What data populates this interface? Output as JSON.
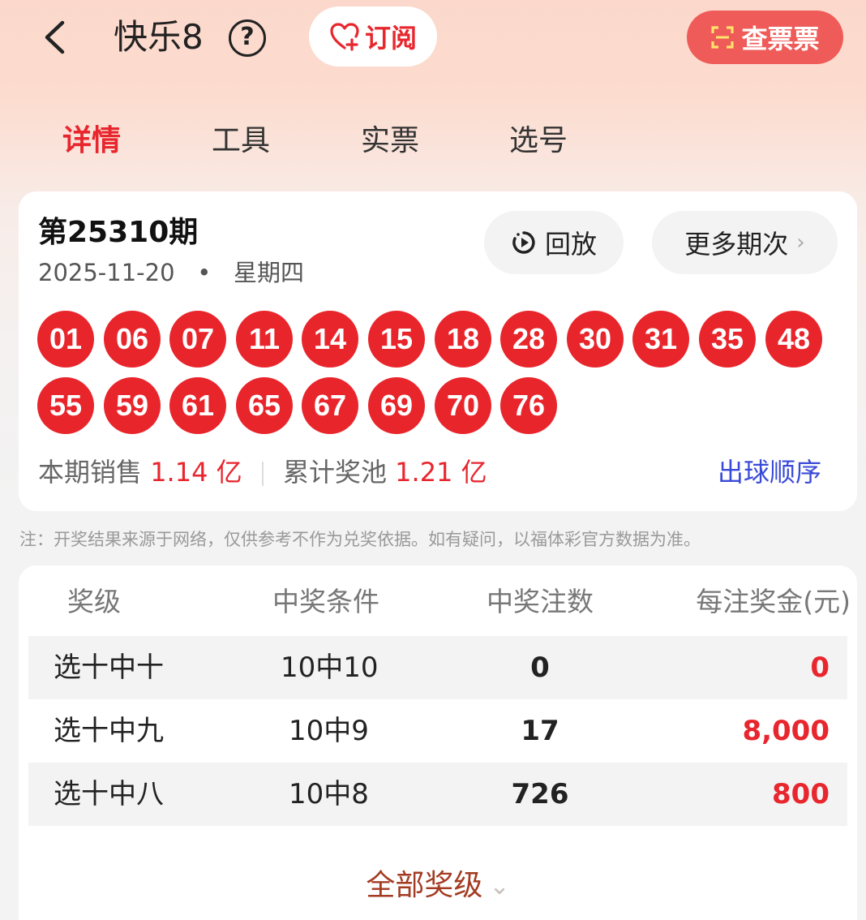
{
  "header": {
    "title": "快乐8",
    "help_symbol": "?",
    "subscribe_label": "订阅",
    "check_ticket_label": "查票票"
  },
  "tabs": [
    {
      "label": "详情",
      "active": true
    },
    {
      "label": "工具",
      "active": false
    },
    {
      "label": "实票",
      "active": false
    },
    {
      "label": "选号",
      "active": false
    }
  ],
  "draw": {
    "issue": "第25310期",
    "date": "2025-11-20",
    "separator": "•",
    "weekday": "星期四",
    "replay_label": "回放",
    "more_label": "更多期次",
    "more_chevron": "›",
    "numbers": [
      "01",
      "06",
      "07",
      "11",
      "14",
      "15",
      "18",
      "28",
      "30",
      "31",
      "35",
      "48",
      "55",
      "59",
      "61",
      "65",
      "67",
      "69",
      "70",
      "76"
    ],
    "sales_label": "本期销售",
    "sales_value": "1.14 亿",
    "pool_label": "累计奖池",
    "pool_value": "1.21 亿",
    "ball_order_link": "出球顺序"
  },
  "note": "注：开奖结果来源于网络，仅供参考不作为兑奖依据。如有疑问，以福体彩官方数据为准。",
  "prize_table": {
    "headers": [
      "奖级",
      "中奖条件",
      "中奖注数",
      "每注奖金(元)"
    ],
    "rows": [
      {
        "level": "选十中十",
        "condition": "10中10",
        "count": "0",
        "amount": "0"
      },
      {
        "level": "选十中九",
        "condition": "10中9",
        "count": "17",
        "amount": "8,000"
      },
      {
        "level": "选十中八",
        "condition": "10中8",
        "count": "726",
        "amount": "800"
      }
    ],
    "all_levels_label": "全部奖级",
    "all_levels_chevron": "⌄"
  },
  "icons": {
    "back": "chevron-left-icon",
    "help": "question-circle-icon",
    "subscribe": "heart-plus-icon",
    "check_ticket": "scan-icon",
    "replay": "replay-icon",
    "more": "chevron-right-icon",
    "all_levels": "chevron-down-icon"
  },
  "colors": {
    "accent_red": "#e8262e",
    "ball_red": "#e9252c",
    "check_ticket_bg": "#ef5b58",
    "link_blue": "#3a4ad8",
    "all_levels_brown": "#a33b22"
  }
}
